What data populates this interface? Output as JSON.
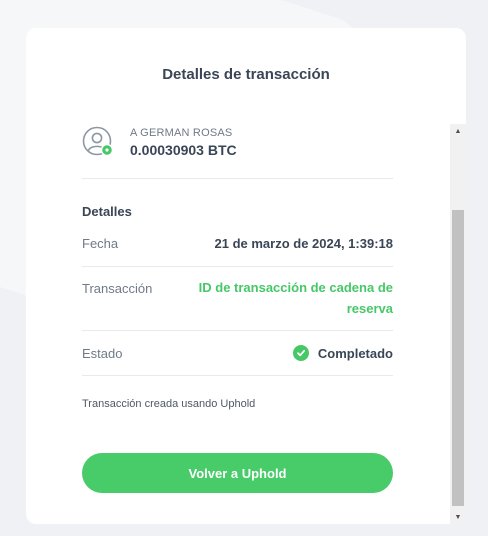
{
  "title": "Detalles de transacción",
  "recipient": {
    "name": "A GERMAN ROSAS",
    "amount": "0.00030903 BTC"
  },
  "details": {
    "section_title": "Detalles",
    "rows": [
      {
        "label": "Fecha",
        "value": "21 de marzo de 2024, 1:39:18"
      },
      {
        "label": "Transacción",
        "value": "ID de transacción de cadena de reserva"
      },
      {
        "label": "Estado",
        "value": "Completado"
      }
    ]
  },
  "footer_note": "Transacción creada usando Uphold",
  "primary_button": "Volver a Uphold",
  "colors": {
    "accent_green": "#46c867",
    "text_dark": "#3a4656",
    "text_muted": "#6f7a88"
  },
  "icons": {
    "avatar": "user-avatar-icon",
    "status": "check-circle-icon"
  }
}
